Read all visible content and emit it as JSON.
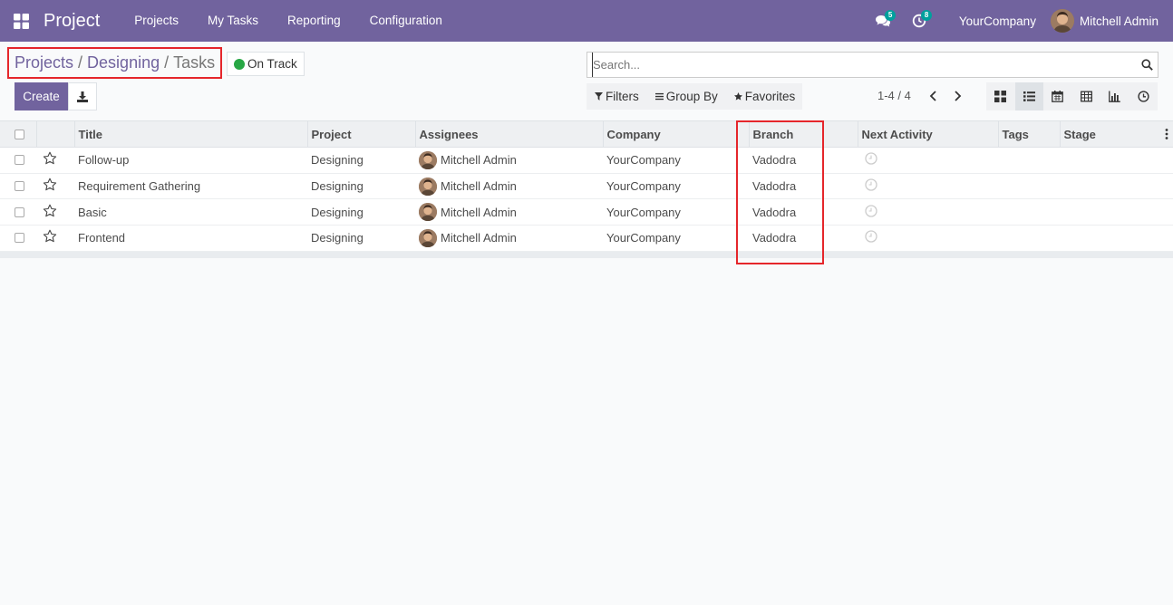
{
  "navbar": {
    "app_name": "Project",
    "menu": [
      "Projects",
      "My Tasks",
      "Reporting",
      "Configuration"
    ],
    "messages_count": "5",
    "activities_count": "8",
    "company": "YourCompany",
    "user": "Mitchell Admin"
  },
  "breadcrumb": {
    "items": [
      "Projects",
      "Designing"
    ],
    "separator": "/",
    "current": "Tasks"
  },
  "status": {
    "label": "On Track",
    "color": "#28a745"
  },
  "search": {
    "placeholder": "Search..."
  },
  "buttons": {
    "create": "Create"
  },
  "search_options": {
    "filters": "Filters",
    "group_by": "Group By",
    "favorites": "Favorites"
  },
  "pager": {
    "value": "1-4 / 4"
  },
  "views": [
    "kanban-view-icon",
    "list-view-icon",
    "calendar-view-icon",
    "pivot-view-icon",
    "graph-view-icon",
    "activity-view-icon"
  ],
  "table": {
    "columns": [
      "Title",
      "Project",
      "Assignees",
      "Company",
      "Branch",
      "Next Activity",
      "Tags",
      "Stage"
    ],
    "rows": [
      {
        "title": "Follow-up",
        "project": "Designing",
        "assignee": "Mitchell Admin",
        "company": "YourCompany",
        "branch": "Vadodra"
      },
      {
        "title": "Requirement Gathering",
        "project": "Designing",
        "assignee": "Mitchell Admin",
        "company": "YourCompany",
        "branch": "Vadodra"
      },
      {
        "title": "Basic",
        "project": "Designing",
        "assignee": "Mitchell Admin",
        "company": "YourCompany",
        "branch": "Vadodra"
      },
      {
        "title": "Frontend",
        "project": "Designing",
        "assignee": "Mitchell Admin",
        "company": "YourCompany",
        "branch": "Vadodra"
      }
    ]
  },
  "colors": {
    "brand": "#71639e",
    "highlight": "#e5262b"
  }
}
